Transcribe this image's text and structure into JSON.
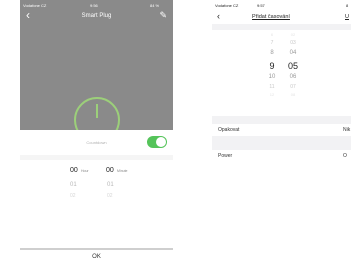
{
  "left_screen": {
    "status": {
      "carrier": "Vodafone CZ",
      "time": "9:56",
      "battery": "84 %"
    },
    "nav": {
      "title": "Smart Plug"
    },
    "countdown": {
      "label": "Countdown",
      "enabled": true
    },
    "picker": {
      "hour_value": "00",
      "hour_unit": "Hour",
      "minute_value": "00",
      "minute_unit": "Minute",
      "hour_next": "01",
      "minute_next": "01",
      "hour_next2": "02",
      "minute_next2": "02"
    },
    "ok_label": "OK",
    "colors": {
      "toggle": "#55c45a",
      "overlay": "#8a8a8a",
      "power": "#9ccf7a"
    }
  },
  "right_screen": {
    "status": {
      "carrier": "Vodafone CZ",
      "time": "9:57",
      "battery": "8"
    },
    "nav": {
      "title": "Přidat časování",
      "save": "U"
    },
    "picker": {
      "hours": [
        "6",
        "7",
        "8",
        "9",
        "10",
        "11",
        "12"
      ],
      "minutes": [
        "02",
        "03",
        "04",
        "05",
        "06",
        "07",
        "08"
      ],
      "selected_hour": "9",
      "selected_minute": "05"
    },
    "repeat": {
      "label": "Opakovat",
      "value": "Nik"
    },
    "power": {
      "label": "Power",
      "value": "O"
    }
  }
}
